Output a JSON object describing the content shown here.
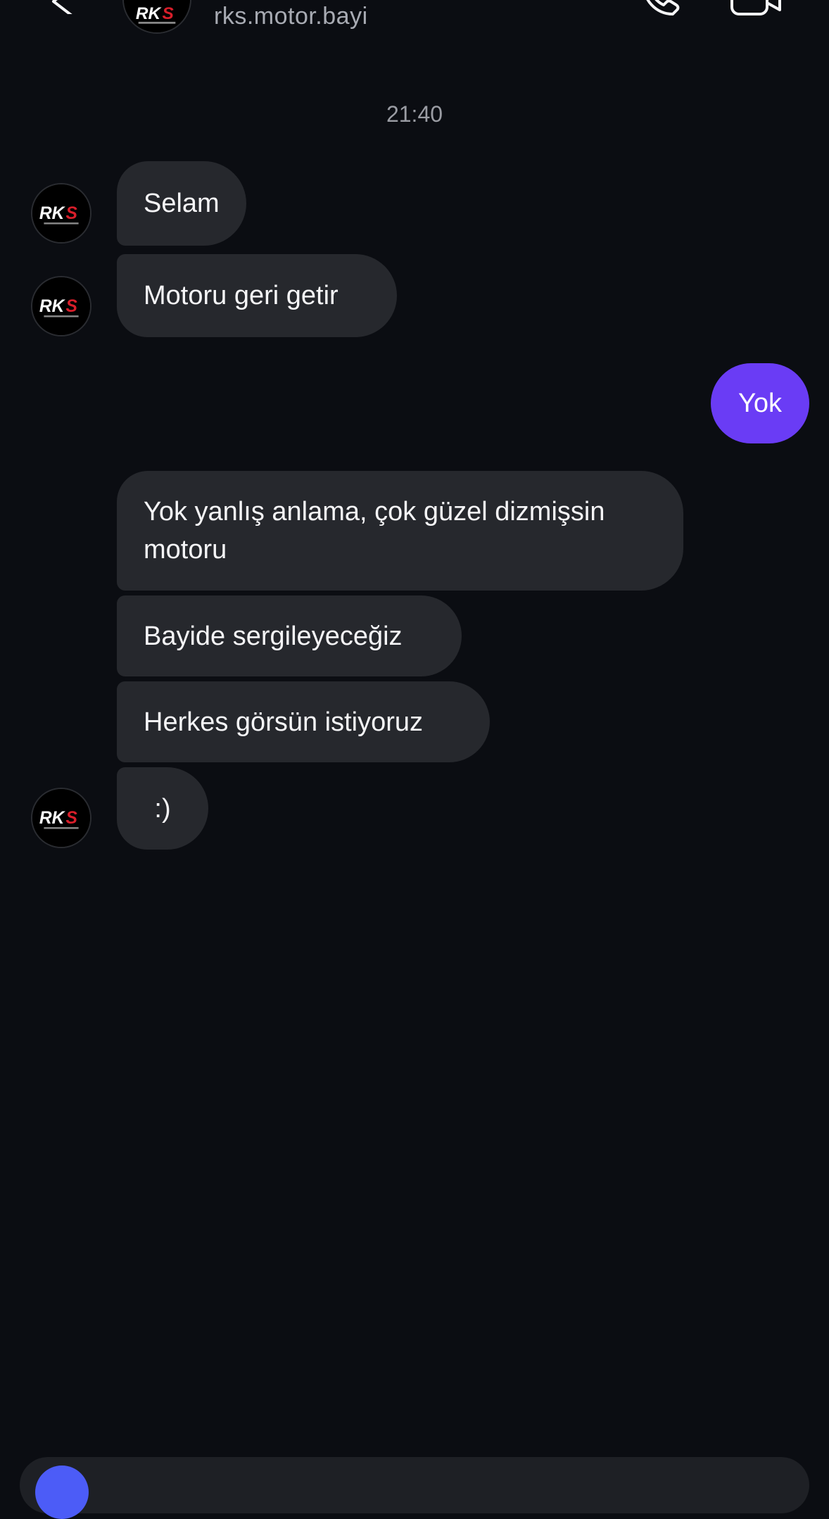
{
  "header": {
    "username": "rks.motor.bayi",
    "back_icon": "chevron-left-icon",
    "call_icon": "phone-icon",
    "video_icon": "video-camera-icon"
  },
  "thread": {
    "timestamp": "21:40",
    "messages": [
      {
        "from": "them",
        "text": "Selam"
      },
      {
        "from": "them",
        "text": "Motoru geri getir"
      },
      {
        "from": "me",
        "text": "Yok"
      },
      {
        "from": "them",
        "text": "Yok yanlış anlama, çok güzel dizmişsin motoru"
      },
      {
        "from": "them",
        "text": "Bayide sergileyeceğiz"
      },
      {
        "from": "them",
        "text": "Herkes görsün istiyoruz"
      },
      {
        "from": "them",
        "text": ":)"
      }
    ]
  },
  "colors": {
    "background": "#0b0d12",
    "incoming_bubble": "#26282d",
    "outgoing_bubble": "#6a3cf5",
    "accent": "#4c5cf7"
  }
}
